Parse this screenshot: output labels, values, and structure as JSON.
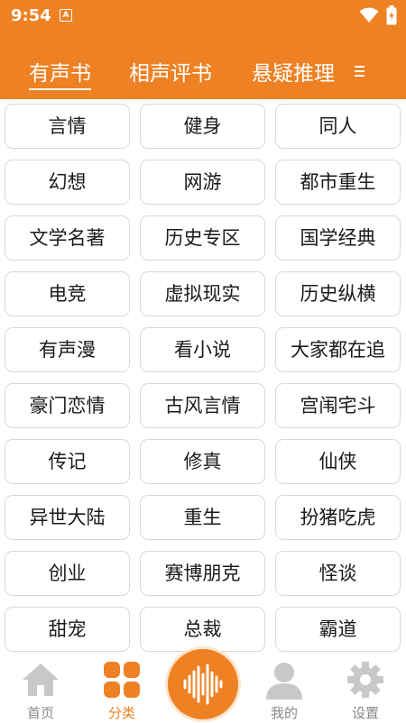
{
  "status_bar": {
    "time": "9:54",
    "notif_letter": "A"
  },
  "tabs": [
    {
      "label": "有声书",
      "active": true
    },
    {
      "label": "相声评书",
      "active": false
    },
    {
      "label": "悬疑推理",
      "active": false
    }
  ],
  "categories": [
    "言情",
    "健身",
    "同人",
    "幻想",
    "网游",
    "都市重生",
    "文学名著",
    "历史专区",
    "国学经典",
    "电竞",
    "虚拟现实",
    "历史纵横",
    "有声漫",
    "看小说",
    "大家都在追",
    "豪门恋情",
    "古风言情",
    "宫闱宅斗",
    "传记",
    "修真",
    "仙侠",
    "异世大陆",
    "重生",
    "扮猪吃虎",
    "创业",
    "赛博朋克",
    "怪谈",
    "甜宠",
    "总裁",
    "霸道"
  ],
  "bottom_nav": [
    {
      "label": "首页",
      "icon": "home-icon",
      "active": false
    },
    {
      "label": "分类",
      "icon": "category-icon",
      "active": true
    },
    {
      "label": "",
      "icon": "audio-wave-icon",
      "active": false
    },
    {
      "label": "我的",
      "icon": "user-icon",
      "active": false
    },
    {
      "label": "设置",
      "icon": "gear-icon",
      "active": false
    }
  ],
  "colors": {
    "accent": "#ee8123",
    "icon_gray": "#c8c8c8",
    "label_gray": "#888888",
    "cell_border": "#d8d8d8"
  }
}
